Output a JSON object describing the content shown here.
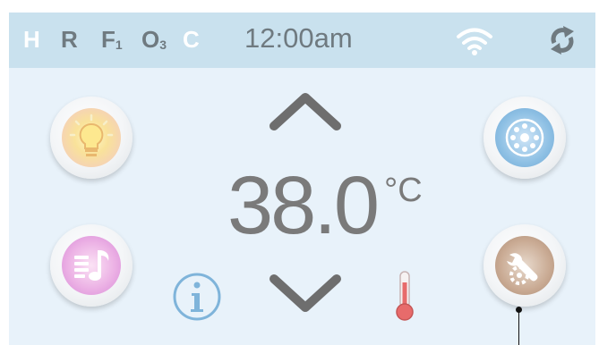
{
  "status_bar": {
    "indicators": [
      {
        "label": "H",
        "sub": "",
        "active": true
      },
      {
        "label": "R",
        "sub": "",
        "active": false
      },
      {
        "label": "F",
        "sub": "1",
        "active": false
      },
      {
        "label": "O",
        "sub": "3",
        "active": false
      },
      {
        "label": "C",
        "sub": "",
        "active": true
      }
    ],
    "clock": "12:00am",
    "wifi_icon": "wifi-icon",
    "sync_icon": "sync-icon"
  },
  "controls": {
    "light": {
      "icon": "lightbulb-icon"
    },
    "music": {
      "icon": "music-icon"
    },
    "jets": {
      "icon": "jets-icon"
    },
    "settings": {
      "icon": "settings-wrench-icon"
    },
    "temp_up": {
      "icon": "chevron-up-icon"
    },
    "temp_down": {
      "icon": "chevron-down-icon"
    },
    "info": {
      "icon": "info-icon"
    },
    "thermometer": {
      "icon": "thermometer-icon"
    }
  },
  "temperature": {
    "value": "38.0",
    "unit": "°C"
  },
  "colors": {
    "screen_bg": "#e8f2fa",
    "status_bar_bg": "#c9e1ee",
    "active_indicator": "#ffffff",
    "inactive_indicator": "#6f7a80",
    "temperature_text": "#7a7a7a"
  }
}
